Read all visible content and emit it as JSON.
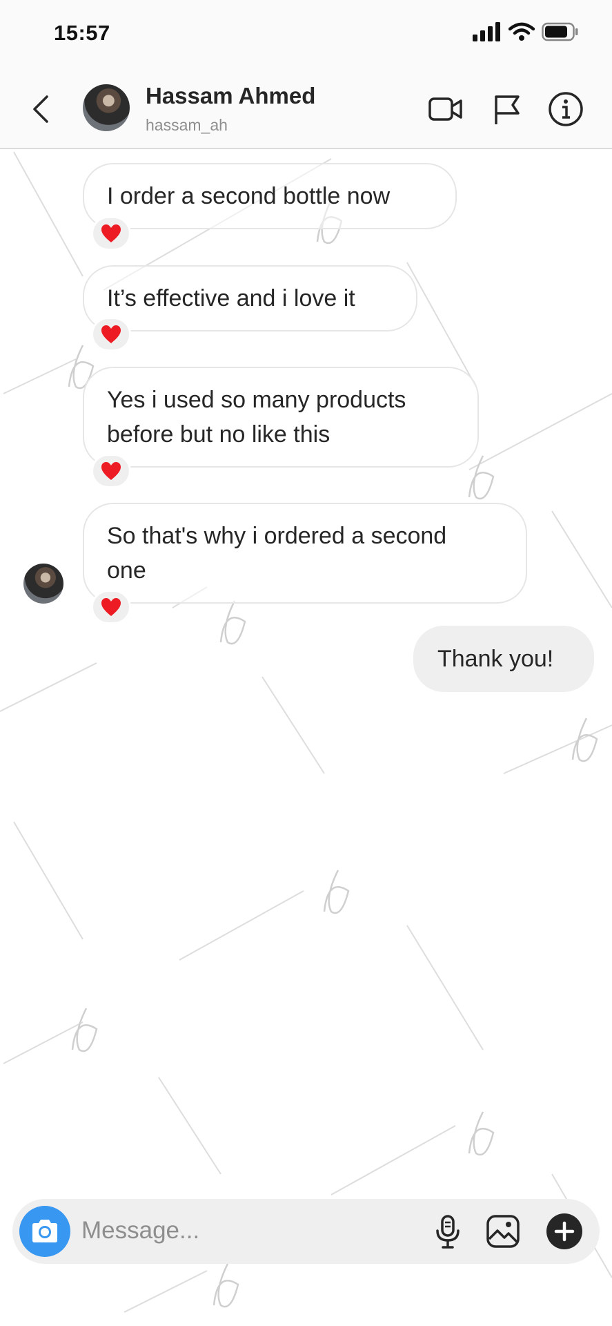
{
  "status_bar": {
    "time": "15:57"
  },
  "header": {
    "name": "Hassam Ahmed",
    "username": "hassam_ah"
  },
  "messages": [
    {
      "text": "I order a second bottle now",
      "reaction": "heart"
    },
    {
      "text": "It’s effective and i love it",
      "reaction": "heart"
    },
    {
      "line1": "Yes i used so many products",
      "line2": "before but no like this",
      "reaction": "heart"
    },
    {
      "line1": "So that's why i ordered a second",
      "line2": "one",
      "reaction": "heart"
    },
    {
      "text": "Thank you!",
      "from_me": true
    }
  ],
  "composer": {
    "placeholder": "Message..."
  },
  "colors": {
    "accent": "#3897f0",
    "heart": "#ed1c24",
    "bubble_me": "#efefef"
  }
}
